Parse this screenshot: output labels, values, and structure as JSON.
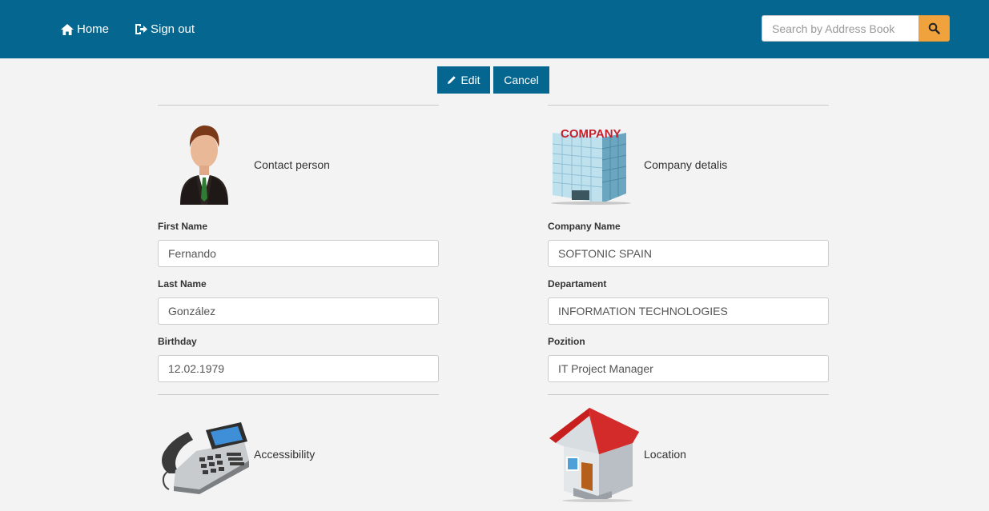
{
  "nav": {
    "home_label": "Home",
    "signout_label": "Sign out",
    "search_placeholder": "Search by Address Book"
  },
  "toolbar": {
    "edit_label": "Edit",
    "cancel_label": "Cancel"
  },
  "contact": {
    "title": "Contact person",
    "first_name": {
      "label": "First Name",
      "value": "Fernando"
    },
    "last_name": {
      "label": "Last Name",
      "value": "González"
    },
    "birthday": {
      "label": "Birthday",
      "value": "12.02.1979"
    }
  },
  "company": {
    "title": "Company detalis",
    "logo_text": "COMPANY",
    "company_name": {
      "label": "Company Name",
      "value": "SOFTONIC SPAIN"
    },
    "department": {
      "label": "Departament",
      "value": "INFORMATION TECHNOLOGIES"
    },
    "position": {
      "label": "Pozition",
      "value": "IT Project Manager"
    }
  },
  "accessibility": {
    "title": "Accessibility"
  },
  "location": {
    "title": "Location"
  },
  "colors": {
    "navbar": "#05678f",
    "accent": "#f0a23c",
    "background": "#f3f3f3"
  }
}
